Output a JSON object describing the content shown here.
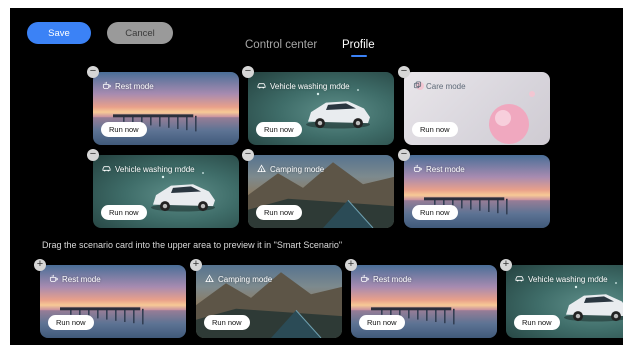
{
  "toolbar": {
    "save_label": "Save",
    "cancel_label": "Cancel"
  },
  "tabs": [
    {
      "label": "Control center",
      "active": false
    },
    {
      "label": "Profile",
      "active": true
    }
  ],
  "colors": {
    "accent": "#3b82f6",
    "background": "#000000"
  },
  "grid_cards": [
    {
      "title": "Rest mode",
      "scene": "rest",
      "icon": "cup-icon",
      "run_label": "Run now"
    },
    {
      "title": "Vehicle washing mode",
      "scene": "wash",
      "icon": "car-icon",
      "run_label": "Run now"
    },
    {
      "title": "Care mode",
      "scene": "care",
      "icon": "care-icon",
      "run_label": "Run now"
    },
    {
      "title": "Vehicle washing mode",
      "scene": "wash",
      "icon": "car-icon",
      "run_label": "Run now"
    },
    {
      "title": "Camping mode",
      "scene": "camp",
      "icon": "tent-icon",
      "run_label": "Run now"
    },
    {
      "title": "Rest mode",
      "scene": "rest",
      "icon": "cup-icon",
      "run_label": "Run now"
    }
  ],
  "instruction": "Drag the scenario card into the upper area to preview it in \"Smart Scenario\"",
  "library_cards": [
    {
      "title": "Rest mode",
      "scene": "rest",
      "icon": "cup-icon",
      "run_label": "Run now"
    },
    {
      "title": "Camping mode",
      "scene": "camp",
      "icon": "tent-icon",
      "run_label": "Run now"
    },
    {
      "title": "Rest mode",
      "scene": "rest",
      "icon": "cup-icon",
      "run_label": "Run now"
    },
    {
      "title": "Vehicle washing mode",
      "scene": "wash",
      "icon": "car-icon",
      "run_label": "Run now"
    }
  ],
  "badges": {
    "remove": "−",
    "add": "+"
  }
}
